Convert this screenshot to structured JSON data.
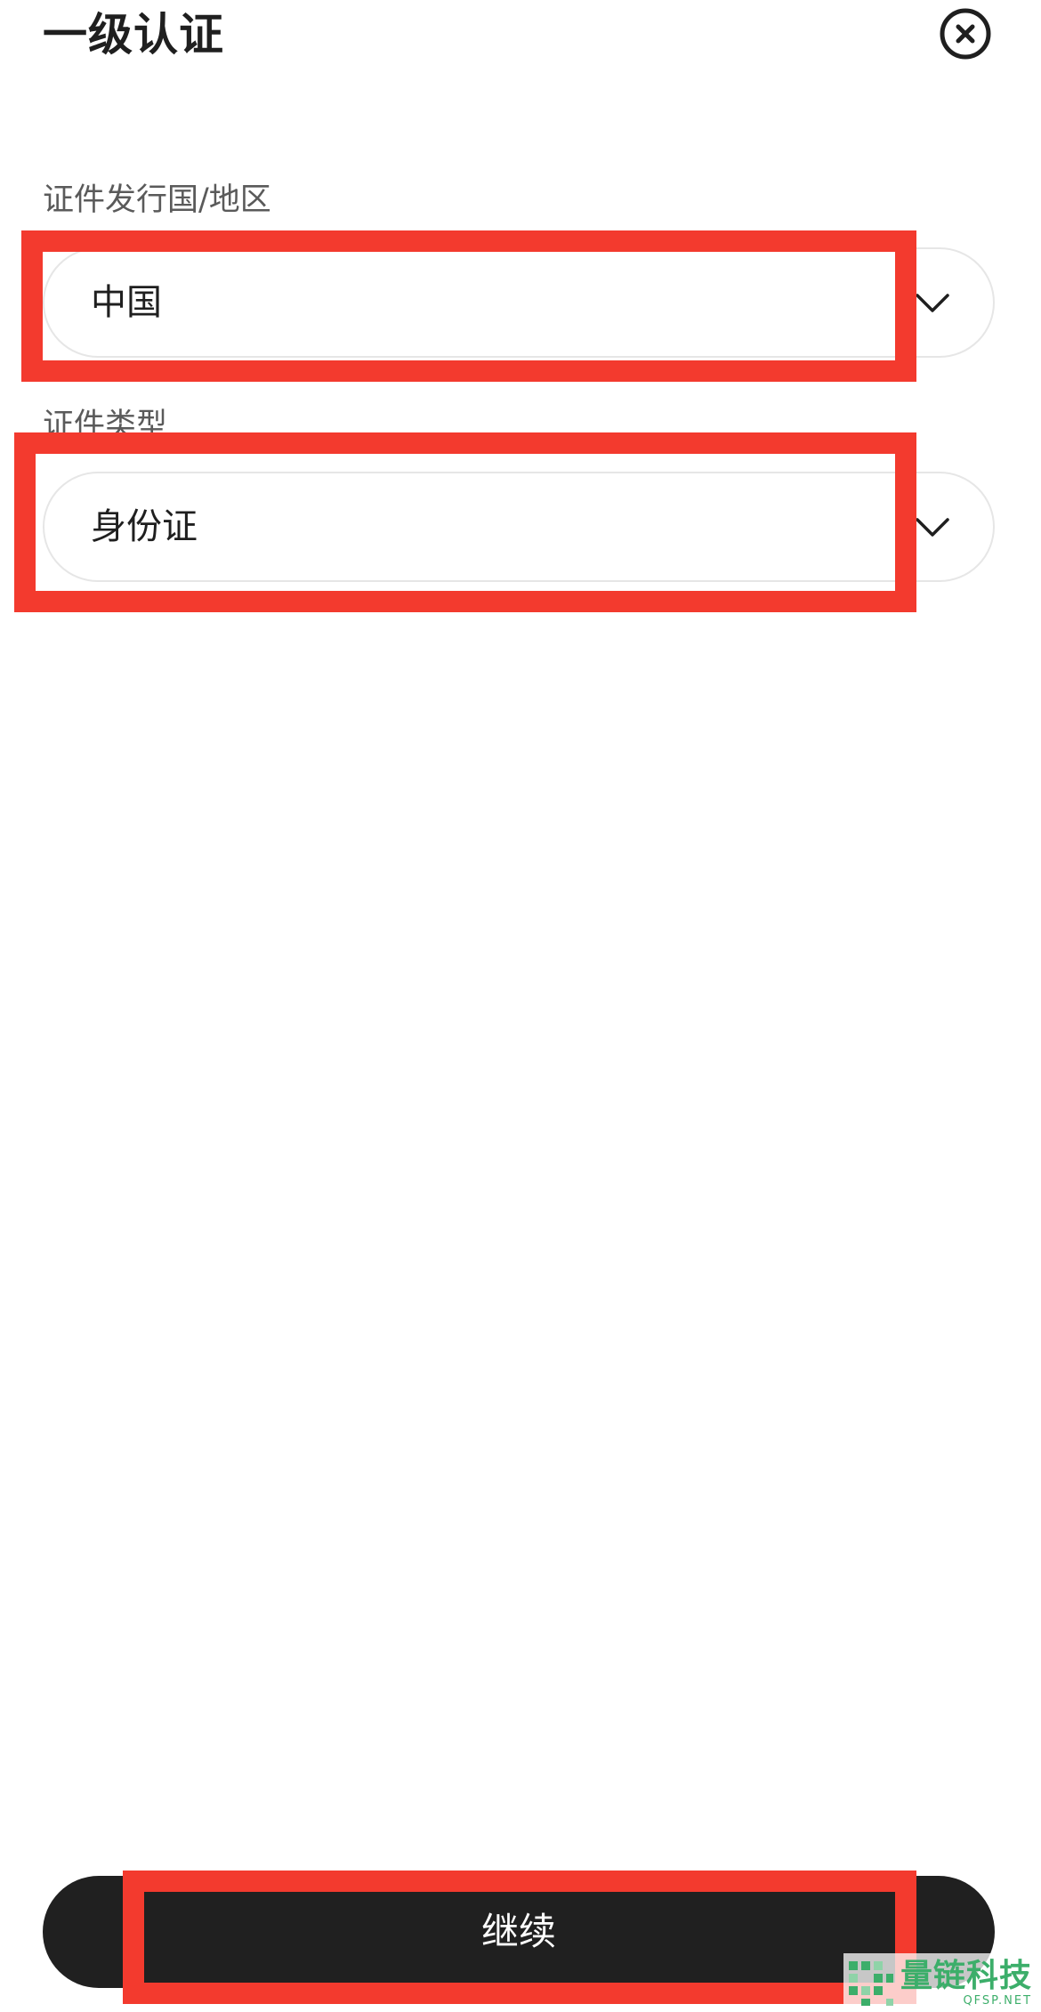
{
  "header": {
    "title": "一级认证",
    "close_icon": "close-circle-icon"
  },
  "form": {
    "country": {
      "label": "证件发行国/地区",
      "value": "中国",
      "icon": "chevron-down-icon"
    },
    "id_type": {
      "label": "证件类型",
      "value": "身份证",
      "icon": "chevron-down-icon"
    }
  },
  "footer": {
    "continue_label": "继续"
  },
  "watermark": {
    "name": "量链科技",
    "domain": "QFSP.NET"
  },
  "colors": {
    "highlight": "#f33a2e",
    "button_bg": "#202020",
    "watermark": "#3cae6a"
  }
}
